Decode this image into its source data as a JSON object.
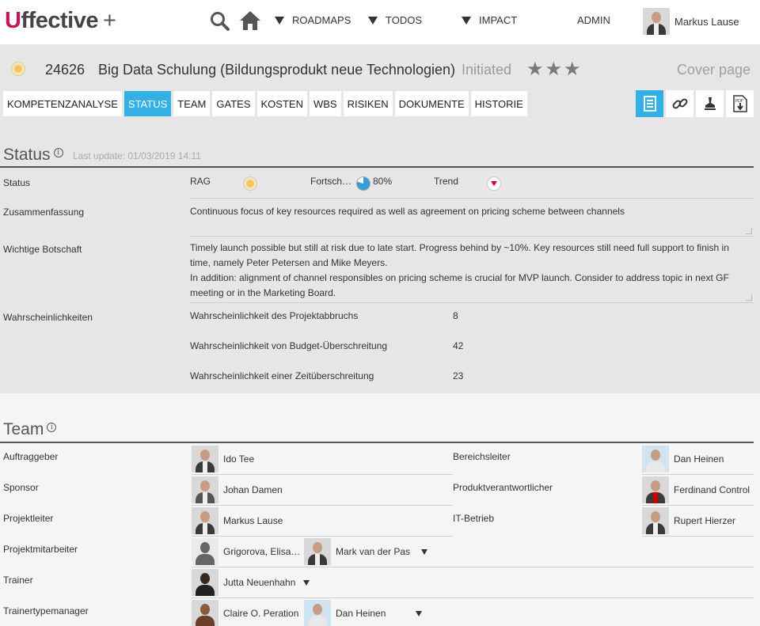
{
  "nav": {
    "logo_u": "U",
    "logo_rest": "ffective",
    "logo_plus": "+",
    "search_icon": "search-icon",
    "home_icon": "home-icon",
    "roadmaps": "ROADMAPS",
    "todos": "TODOS",
    "impact": "IMPACT",
    "admin": "ADMIN",
    "user_name": "Markus Lause"
  },
  "project": {
    "id": "24626",
    "title": "Big Data Schulung (Bildungsprodukt neue Technologien)",
    "state": "Initiated",
    "rating_stars": 3,
    "cover_page": "Cover page"
  },
  "tabs": [
    {
      "label": "KOMPETENZANALYSE",
      "active": false
    },
    {
      "label": "STATUS",
      "active": true
    },
    {
      "label": "TEAM",
      "active": false
    },
    {
      "label": "GATES",
      "active": false
    },
    {
      "label": "KOSTEN",
      "active": false
    },
    {
      "label": "WBS",
      "active": false
    },
    {
      "label": "RISIKEN",
      "active": false
    },
    {
      "label": "DOKUMENTE",
      "active": false
    },
    {
      "label": "HISTORIE",
      "active": false
    }
  ],
  "tools": [
    "report-icon",
    "link-icon",
    "stamp-icon",
    "pdf-download-icon"
  ],
  "status": {
    "title": "Status",
    "last_update": "Last update: 01/03/2019 14:11",
    "row_status_label": "Status",
    "rag_label": "RAG",
    "rag_color": "#f7c356",
    "progress_label": "Fortsch…",
    "progress_value": "80%",
    "progress_fraction": 0.8,
    "trend_label": "Trend",
    "trend_direction": "down",
    "summary_label": "Zusammenfassung",
    "summary_text": "Continuous focus of key resources required as well as agreement on pricing scheme between channels",
    "message_label": "Wichtige Botschaft",
    "message_line1": "Timely launch possible but still at risk due to late start. Progress behind by ~10%. Key resources still need full support to finish in",
    "message_line2": "time, namely Peter Petersen and Mike Meyers.",
    "message_line3": "In addition: alignment of channel responsibles on pricing scheme is crucial for MVP launch. Consider to address topic in next GF",
    "message_line4": "meeting or in the Marketing Board.",
    "prob_label": "Wahrscheinlichkeiten",
    "probabilities": [
      {
        "label": "Wahrscheinlichkeit des Projektabbruchs",
        "value": "8"
      },
      {
        "label": "Wahrscheinlichkeit von Budget-Überschreitung",
        "value": "42"
      },
      {
        "label": "Wahrscheinlichkeit einer Zeitüberschreitung",
        "value": "23"
      }
    ]
  },
  "team": {
    "title": "Team",
    "rows": [
      {
        "label": "Auftraggeber",
        "members": [
          "Ido Tee"
        ]
      },
      {
        "label": "Sponsor",
        "members": [
          "Johan Damen"
        ]
      },
      {
        "label": "Projektleiter",
        "members": [
          "Markus Lause"
        ]
      },
      {
        "label": "Projektmitarbeiter",
        "members": [
          "Grigorova, Elisa…",
          "Mark van der Pas"
        ]
      },
      {
        "label": "Trainer",
        "members": [
          "Jutta Neuenhahn"
        ]
      },
      {
        "label": "Trainertypemanager",
        "members": [
          "Claire O. Peration",
          "Dan Heinen"
        ]
      }
    ],
    "right_rows": [
      {
        "label": "Bereichsleiter",
        "member": "Dan Heinen"
      },
      {
        "label": "Produktverantwortlicher",
        "member": "Ferdinand Control"
      },
      {
        "label": "IT-Betrieb",
        "member": "Rupert Hierzer"
      }
    ]
  }
}
